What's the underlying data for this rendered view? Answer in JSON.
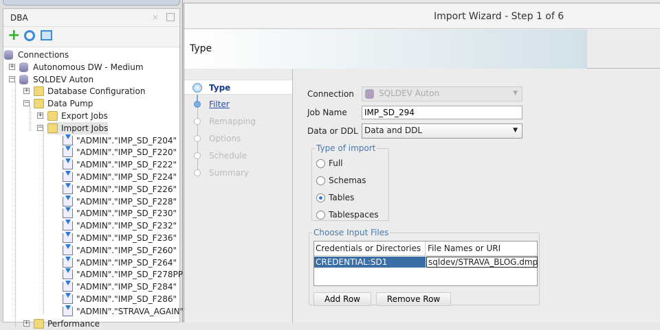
{
  "navigator": {
    "title": "DBA",
    "toolbar": [
      "add-connection-icon",
      "refresh-icon",
      "collapse-icon"
    ],
    "root": "Connections",
    "connections": [
      "Autonomous DW - Medium",
      "SQLDEV Auton"
    ],
    "sqldev_children": [
      "Database Configuration",
      "Data Pump",
      "Performance"
    ],
    "data_pump_children": [
      "Export Jobs",
      "Import Jobs"
    ],
    "import_jobs": [
      "\"ADMIN\".\"IMP_SD_F204\"",
      "\"ADMIN\".\"IMP_SD_F220\"",
      "\"ADMIN\".\"IMP_SD_F222\"",
      "\"ADMIN\".\"IMP_SD_F224\"",
      "\"ADMIN\".\"IMP_SD_F226\"",
      "\"ADMIN\".\"IMP_SD_F228\"",
      "\"ADMIN\".\"IMP_SD_F230\"",
      "\"ADMIN\".\"IMP_SD_F232\"",
      "\"ADMIN\".\"IMP_SD_F236\"",
      "\"ADMIN\".\"IMP_SD_F260\"",
      "\"ADMIN\".\"IMP_SD_F264\"",
      "\"ADMIN\".\"IMP_SD_F278PP\"",
      "\"ADMIN\".\"IMP_SD_F284\"",
      "\"ADMIN\".\"IMP_SD_F286\"",
      "\"ADMIN\".\"STRAVA_AGAIN\""
    ]
  },
  "wizard": {
    "title": "Import Wizard - Step 1 of 6",
    "header": "Type",
    "steps": [
      "Type",
      "Filter",
      "Remapping",
      "Options",
      "Schedule",
      "Summary"
    ],
    "form": {
      "connection_label": "Connection",
      "connection_value": "SQLDEV Auton",
      "job_name_label": "Job Name",
      "job_name_value": "IMP_SD_294",
      "data_ddl_label": "Data or DDL",
      "data_ddl_value": "Data and DDL",
      "type_group": "Type of import",
      "types": [
        "Full",
        "Schemas",
        "Tables",
        "Tablespaces"
      ],
      "selected_type": "Tables",
      "files_group": "Choose Input Files",
      "columns": [
        "Credentials or Directories",
        "File Names or URI"
      ],
      "rows": [
        [
          "CREDENTIAL:SD1",
          "sqldev/STRAVA_BLOG.dmp"
        ]
      ],
      "add_row": "Add Row",
      "remove_row": "Remove Row"
    }
  },
  "colors": {
    "selection": "#3a6ea5",
    "accent": "#4a7ab0"
  }
}
